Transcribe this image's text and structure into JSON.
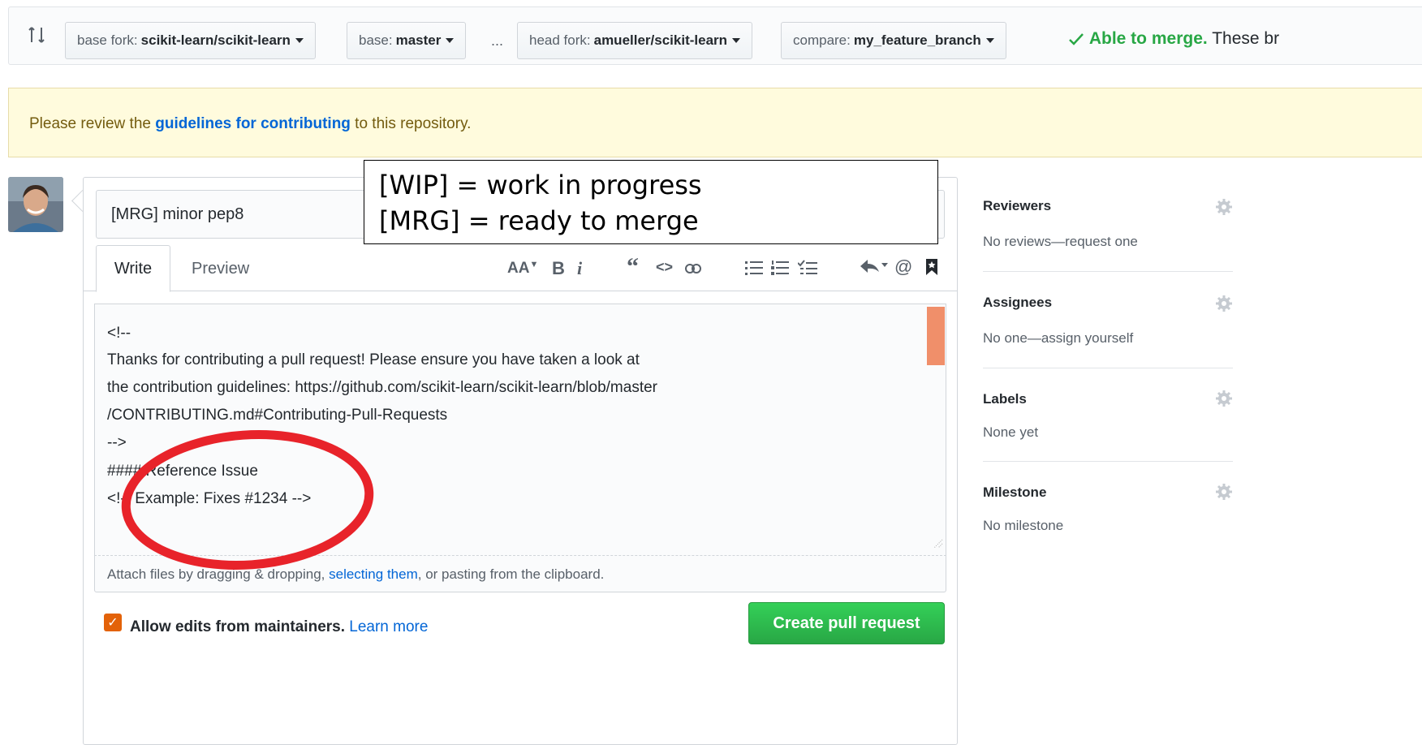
{
  "compare_bar": {
    "base_fork_label": "base fork:",
    "base_fork_value": "scikit-learn/scikit-learn",
    "base_label": "base:",
    "base_value": "master",
    "ellipsis": "...",
    "head_fork_label": "head fork:",
    "head_fork_value": "amueller/scikit-learn",
    "compare_label": "compare:",
    "compare_value": "my_feature_branch",
    "status_ok": "Able to merge.",
    "status_rest": "These br"
  },
  "flash": {
    "before": "Please review the ",
    "link": "guidelines for contributing",
    "after": " to this repository."
  },
  "annotation": {
    "line1": "[WIP] = work in progress",
    "line2": "[MRG] = ready to merge"
  },
  "composer": {
    "title_value": "[MRG] minor pep8",
    "tab_write": "Write",
    "tab_preview": "Preview",
    "toolbar": {
      "heading": "AA",
      "bold": "B",
      "italic": "i",
      "quote": "“",
      "code": "<>",
      "link": "⦾"
    },
    "body_lines": [
      "<!--",
      "Thanks for contributing a pull request! Please ensure you have taken a look at",
      "the contribution guidelines: https://github.com/scikit-learn/scikit-learn/blob/master",
      "/CONTRIBUTING.md#Contributing-Pull-Requests",
      "-->",
      "#### Reference Issue",
      "<!-- Example: Fixes #1234 -->"
    ],
    "attach_before": "Attach files by dragging & dropping, ",
    "attach_link": "selecting them",
    "attach_after": ", or pasting from the clipboard.",
    "allow_edits": "Allow edits from maintainers.",
    "learn_more": "Learn more",
    "create_button": "Create pull request"
  },
  "sidebar": {
    "reviewers_title": "Reviewers",
    "reviewers_text": "No reviews—request one",
    "assignees_title": "Assignees",
    "assignees_text": "No one—assign yourself",
    "labels_title": "Labels",
    "labels_text": "None yet",
    "milestone_title": "Milestone",
    "milestone_text": "No milestone"
  },
  "colors": {
    "link": "#0366d6",
    "success": "#28a745",
    "checkbox": "#e36209",
    "annotation_circle": "#e8232a",
    "scroll_thumb": "#f08f6a"
  }
}
